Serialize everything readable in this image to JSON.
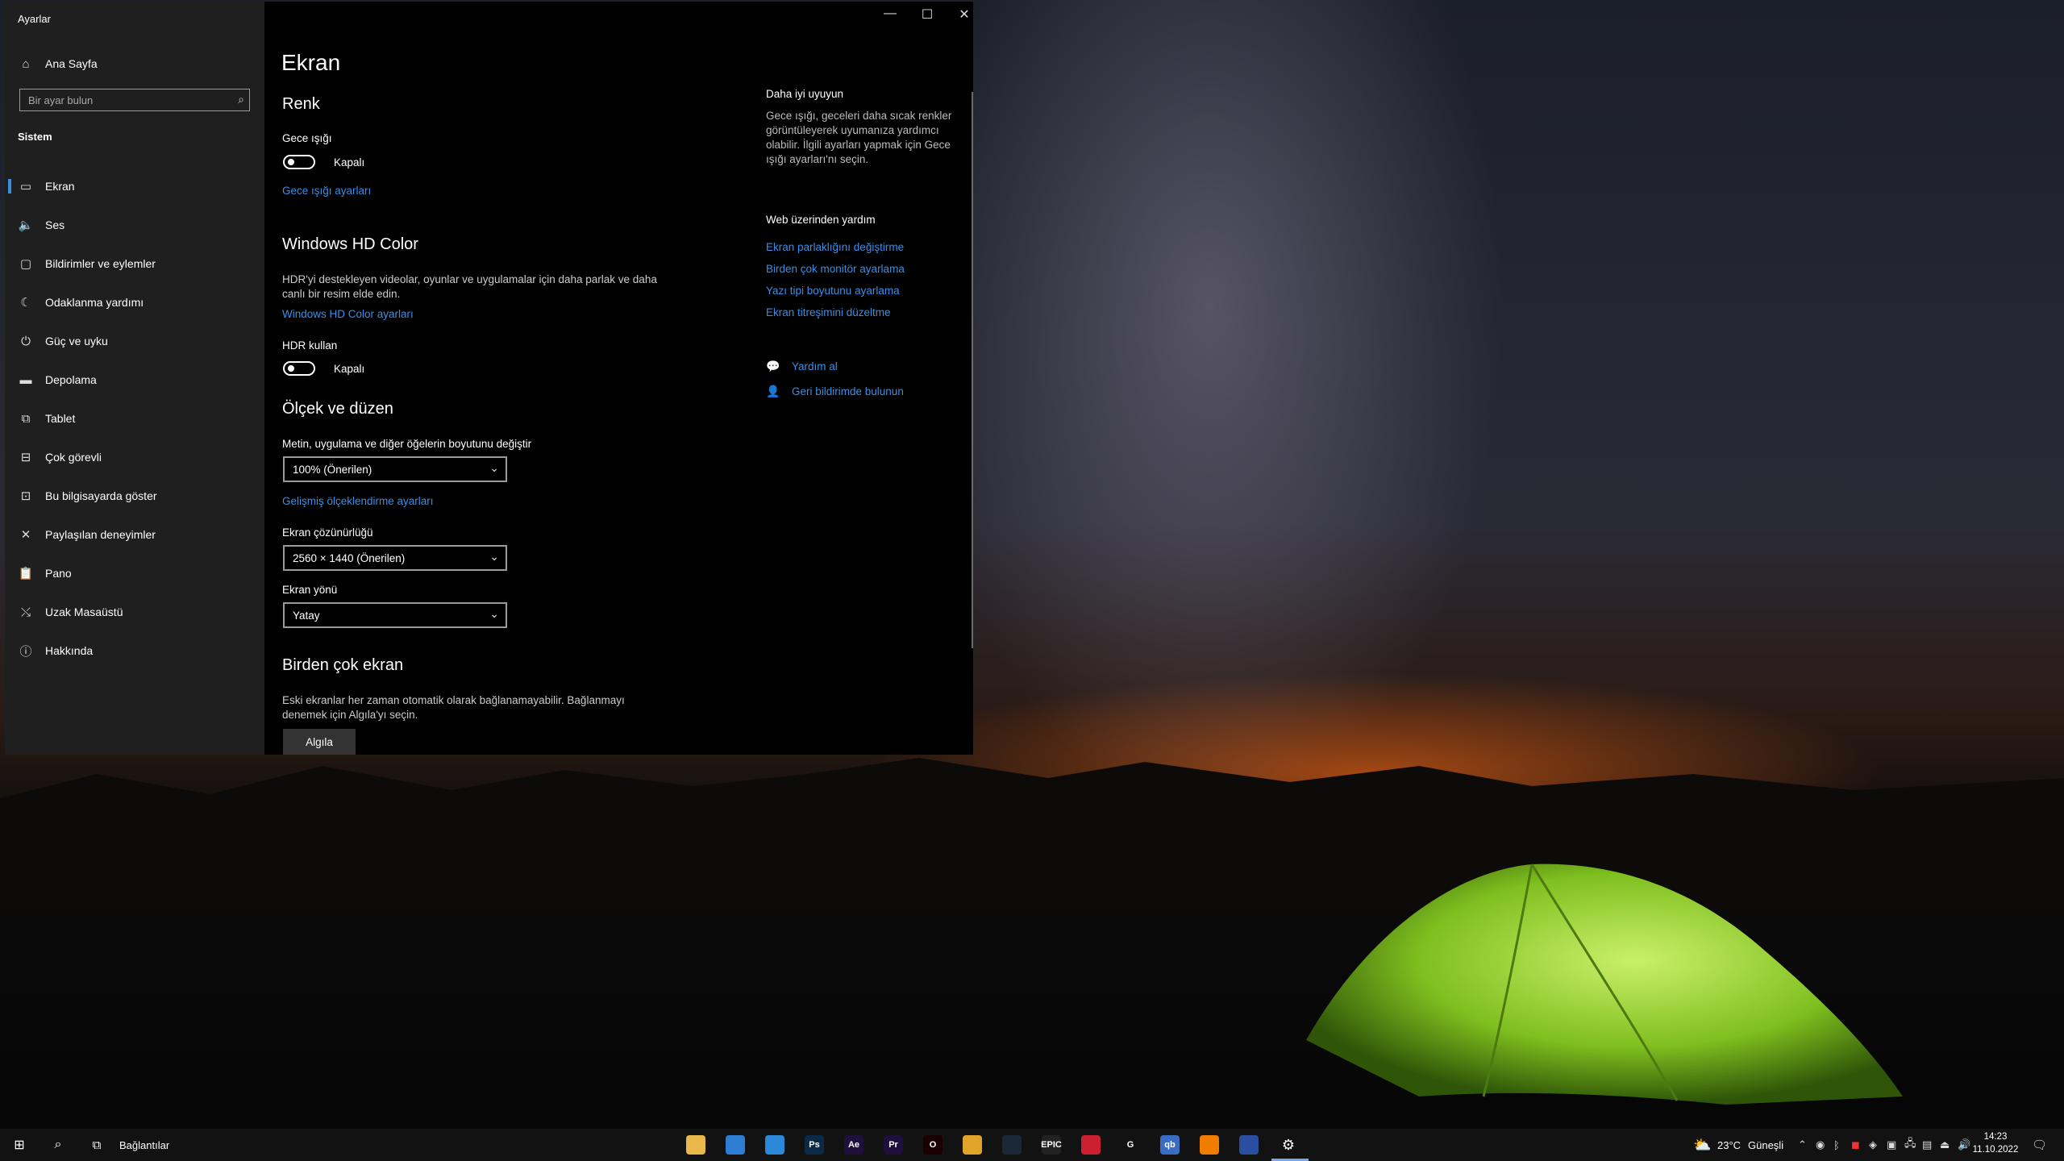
{
  "window": {
    "title": "Ayarlar",
    "controls": {
      "minimize": "—",
      "maximize": "☐",
      "close": "✕"
    }
  },
  "sidebar": {
    "home": "Ana Sayfa",
    "search_placeholder": "Bir ayar bulun",
    "section": "Sistem",
    "items": [
      {
        "label": "Ekran",
        "icon": "monitor-icon"
      },
      {
        "label": "Ses",
        "icon": "speaker-icon"
      },
      {
        "label": "Bildirimler ve eylemler",
        "icon": "notification-icon"
      },
      {
        "label": "Odaklanma yardımı",
        "icon": "moon-icon"
      },
      {
        "label": "Güç ve uyku",
        "icon": "power-icon"
      },
      {
        "label": "Depolama",
        "icon": "storage-icon"
      },
      {
        "label": "Tablet",
        "icon": "tablet-icon"
      },
      {
        "label": "Çok görevli",
        "icon": "multitask-icon"
      },
      {
        "label": "Bu bilgisayarda göster",
        "icon": "project-icon"
      },
      {
        "label": "Paylaşılan deneyimler",
        "icon": "shared-icon"
      },
      {
        "label": "Pano",
        "icon": "clipboard-icon"
      },
      {
        "label": "Uzak Masaüstü",
        "icon": "remote-icon"
      },
      {
        "label": "Hakkında",
        "icon": "info-icon"
      }
    ]
  },
  "main": {
    "title": "Ekran",
    "renk": {
      "heading": "Renk",
      "night_light_label": "Gece ışığı",
      "night_light_state": "Kapalı",
      "night_light_link": "Gece ışığı ayarları"
    },
    "hd_color": {
      "heading": "Windows HD Color",
      "desc": "HDR'yi destekleyen videolar, oyunlar ve uygulamalar için daha parlak ve daha canlı bir resim elde edin.",
      "link": "Windows HD Color ayarları",
      "hdr_label": "HDR kullan",
      "hdr_state": "Kapalı"
    },
    "scale": {
      "heading": "Ölçek ve düzen",
      "size_label": "Metin, uygulama ve diğer öğelerin boyutunu değiştir",
      "size_value": "100% (Önerilen)",
      "advanced_link": "Gelişmiş ölçeklendirme ayarları",
      "resolution_label": "Ekran çözünürlüğü",
      "resolution_value": "2560 × 1440 (Önerilen)",
      "orientation_label": "Ekran yönü",
      "orientation_value": "Yatay"
    },
    "multi": {
      "heading": "Birden çok ekran",
      "desc": "Eski ekranlar her zaman otomatik olarak bağlanamayabilir. Bağlanmayı denemek için Algıla'yı seçin.",
      "button": "Algıla"
    }
  },
  "right": {
    "sleep_heading": "Daha iyi uyuyun",
    "sleep_text": "Gece ışığı, geceleri daha sıcak renkler görüntüleyerek uyumanıza yardımcı olabilir. İlgili ayarları yapmak için Gece ışığı ayarları'nı seçin.",
    "web_heading": "Web üzerinden yardım",
    "web_links": [
      "Ekran parlaklığını değiştirme",
      "Birden çok monitör ayarlama",
      "Yazı tipi boyutunu ayarlama",
      "Ekran titreşimini düzeltme"
    ],
    "help": "Yardım al",
    "feedback": "Geri bildirimde bulunun"
  },
  "taskbar": {
    "links_label": "Bağlantılar",
    "weather_temp": "23°C",
    "weather_text": "Güneşli",
    "time": "14:23",
    "date": "11.10.2022",
    "apps": [
      {
        "name": "file-explorer",
        "text": "",
        "color": "#e8b84a"
      },
      {
        "name": "store",
        "text": "",
        "color": "#2d7dd2"
      },
      {
        "name": "mail",
        "text": "",
        "color": "#2b88d8"
      },
      {
        "name": "photoshop",
        "text": "Ps",
        "color": "#0b2a45"
      },
      {
        "name": "after-effects",
        "text": "Ae",
        "color": "#1e0f3c"
      },
      {
        "name": "premiere",
        "text": "Pr",
        "color": "#1e0f3c"
      },
      {
        "name": "opera",
        "text": "O",
        "color": "#1a0000"
      },
      {
        "name": "chrome",
        "text": "",
        "color": "#e0a42a"
      },
      {
        "name": "steam",
        "text": "",
        "color": "#1b2838"
      },
      {
        "name": "epic-games",
        "text": "EPIC",
        "color": "#222222"
      },
      {
        "name": "amd",
        "text": "",
        "color": "#cc1f2f"
      },
      {
        "name": "logitech",
        "text": "G",
        "color": "#121212"
      },
      {
        "name": "qbittorrent",
        "text": "qb",
        "color": "#3b6cc4"
      },
      {
        "name": "vlc",
        "text": "",
        "color": "#f07d00"
      },
      {
        "name": "video-editor",
        "text": "",
        "color": "#2a4fa0"
      },
      {
        "name": "settings",
        "text": "",
        "color": "#121212"
      }
    ]
  }
}
